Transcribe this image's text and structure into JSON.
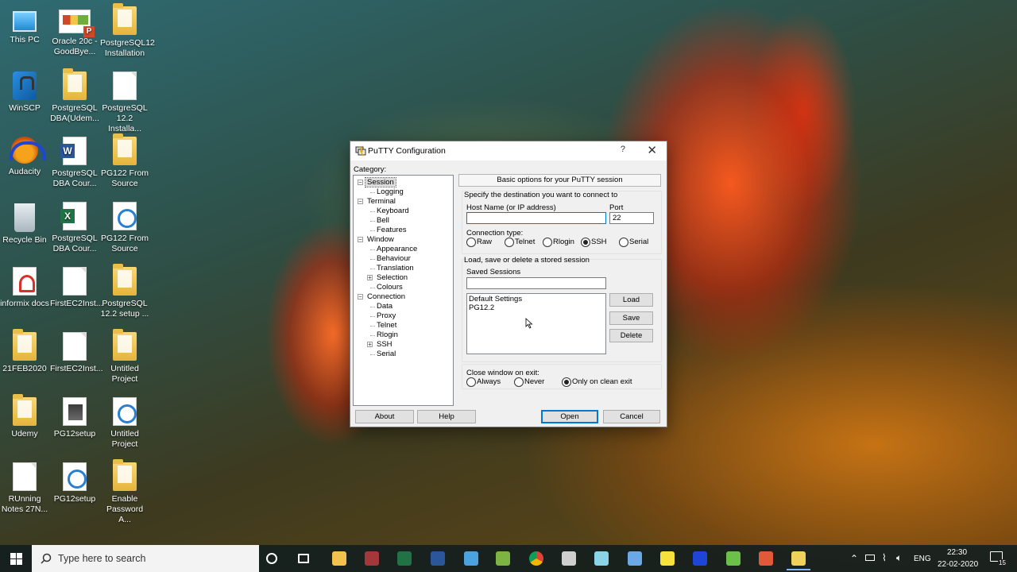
{
  "desktop": {
    "icons": [
      {
        "label": "This PC",
        "icon": "computer-icon"
      },
      {
        "label": "Oracle 20c - GoodBye...",
        "icon": "powerpoint-icon"
      },
      {
        "label": "PostgreSQL12 Installation",
        "icon": "folder-icon"
      },
      {
        "label": "WinSCP",
        "icon": "winscp-icon"
      },
      {
        "label": "PostgreSQL DBA(Udem...",
        "icon": "folder-icon"
      },
      {
        "label": "PostgreSQL 12.2 Installa...",
        "icon": "document-icon"
      },
      {
        "label": "Audacity",
        "icon": "audacity-icon"
      },
      {
        "label": "PostgreSQL DBA Cour...",
        "icon": "word-icon"
      },
      {
        "label": "PG122 From Source",
        "icon": "folder-icon"
      },
      {
        "label": "Recycle Bin",
        "icon": "recycle-bin-icon"
      },
      {
        "label": "PostgreSQL DBA Cour...",
        "icon": "excel-icon"
      },
      {
        "label": "PG122 From Source",
        "icon": "disc-icon"
      },
      {
        "label": "informix docs",
        "icon": "pdf-icon"
      },
      {
        "label": "FirstEC2Inst...",
        "icon": "document-icon"
      },
      {
        "label": "PostgreSQL 12.2 setup ...",
        "icon": "folder-icon"
      },
      {
        "label": "21FEB2020",
        "icon": "folder-icon"
      },
      {
        "label": "FirstEC2Inst...",
        "icon": "document-icon"
      },
      {
        "label": "Untitled Project",
        "icon": "folder-icon"
      },
      {
        "label": "Udemy",
        "icon": "folder-icon"
      },
      {
        "label": "PG12setup",
        "icon": "setup-icon"
      },
      {
        "label": "Untitled Project",
        "icon": "disc-icon"
      },
      {
        "label": "RUnning Notes 27N...",
        "icon": "document-icon"
      },
      {
        "label": "PG12setup",
        "icon": "disc-icon"
      },
      {
        "label": "Enable Password A...",
        "icon": "folder-icon"
      }
    ]
  },
  "dialog": {
    "title": "PuTTY Configuration",
    "help_glyph": "?",
    "close_glyph": "✕",
    "category_label": "Category:",
    "tree": [
      {
        "label": "Session",
        "level": 0,
        "expand": "-"
      },
      {
        "label": "Logging",
        "level": 1
      },
      {
        "label": "Terminal",
        "level": 0,
        "expand": "-"
      },
      {
        "label": "Keyboard",
        "level": 1
      },
      {
        "label": "Bell",
        "level": 1
      },
      {
        "label": "Features",
        "level": 1
      },
      {
        "label": "Window",
        "level": 0,
        "expand": "-"
      },
      {
        "label": "Appearance",
        "level": 1
      },
      {
        "label": "Behaviour",
        "level": 1
      },
      {
        "label": "Translation",
        "level": 1
      },
      {
        "label": "Selection",
        "level": 1,
        "expand": "+"
      },
      {
        "label": "Colours",
        "level": 1
      },
      {
        "label": "Connection",
        "level": 0,
        "expand": "-"
      },
      {
        "label": "Data",
        "level": 1
      },
      {
        "label": "Proxy",
        "level": 1
      },
      {
        "label": "Telnet",
        "level": 1
      },
      {
        "label": "Rlogin",
        "level": 1
      },
      {
        "label": "SSH",
        "level": 1,
        "expand": "+"
      },
      {
        "label": "Serial",
        "level": 1
      }
    ],
    "selected_category": "Session",
    "section_header": "Basic options for your PuTTY session",
    "destination_label": "Specify the destination you want to connect to",
    "host_label": "Host Name (or IP address)",
    "host_value": "",
    "port_label": "Port",
    "port_value": "22",
    "conn_type_label": "Connection type:",
    "conn_types": [
      {
        "label": "Raw",
        "selected": false
      },
      {
        "label": "Telnet",
        "selected": false
      },
      {
        "label": "Rlogin",
        "selected": false
      },
      {
        "label": "SSH",
        "selected": true
      },
      {
        "label": "Serial",
        "selected": false
      }
    ],
    "sessions_group_label": "Load, save or delete a stored session",
    "saved_sessions_label": "Saved Sessions",
    "saved_sessions_value": "",
    "sessions": [
      "Default Settings",
      "PG12.2"
    ],
    "load_button": "Load",
    "save_button": "Save",
    "delete_button": "Delete",
    "close_window_label": "Close window on exit:",
    "close_options": [
      {
        "label": "Always",
        "selected": false
      },
      {
        "label": "Never",
        "selected": false
      },
      {
        "label": "Only on clean exit",
        "selected": true
      }
    ],
    "about_button": "About",
    "help_button": "Help",
    "open_button": "Open",
    "cancel_button": "Cancel"
  },
  "taskbar": {
    "search_placeholder": "Type here to search",
    "apps": [
      "cortana-icon",
      "task-view-icon",
      "file-explorer-icon",
      "access-icon",
      "excel-icon",
      "word-icon",
      "paint-icon",
      "notepad-icon",
      "chrome-icon",
      "calculator-icon",
      "generic-app-icon",
      "network-icon",
      "sticky-notes-icon",
      "audacity-icon",
      "green-app-icon",
      "red-app-icon",
      "putty-icon"
    ],
    "language": "ENG",
    "time": "22:30",
    "date": "22-02-2020",
    "notification_count": "15"
  }
}
